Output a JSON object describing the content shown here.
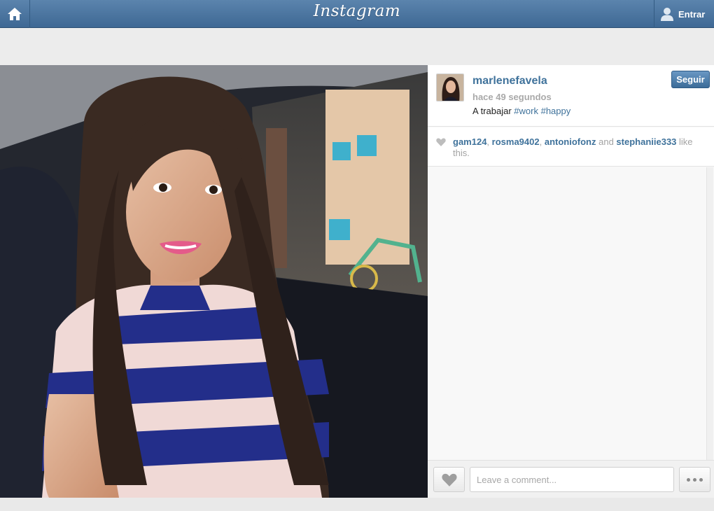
{
  "topbar": {
    "logo": "Instagram",
    "login_label": "Entrar"
  },
  "post": {
    "username": "marlenefavela",
    "timestamp": "hace 49 segundos",
    "caption_text": "A trabajar",
    "hashtags": [
      "#work",
      "#happy"
    ],
    "follow_label": "Seguir"
  },
  "likes": {
    "users": [
      "gam124",
      "rosma9402",
      "antoniofonz",
      "stephaniie333"
    ],
    "separator": ", ",
    "and": " and ",
    "suffix": " like this."
  },
  "comment": {
    "placeholder": "Leave a comment..."
  },
  "colors": {
    "accent": "#3f729b",
    "topbar": "#4a76a2"
  },
  "icons": {
    "home": "home-icon",
    "user": "user-icon",
    "heart": "heart-icon",
    "more": "more-icon"
  }
}
